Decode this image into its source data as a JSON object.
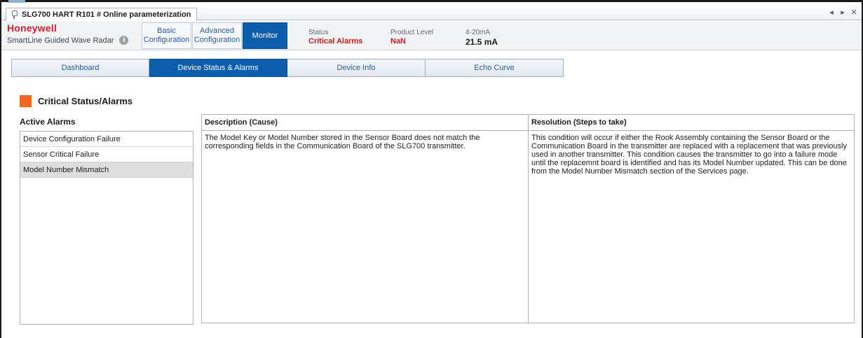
{
  "window": {
    "tab_title": "SLG700 HART R101 # Online parameterization",
    "controls": [
      "◂",
      "▸",
      "✕"
    ]
  },
  "header": {
    "brand": "Honeywell",
    "product": "SmartLine Guided Wave Radar",
    "nav": [
      {
        "label": "Basic Configuration",
        "active": false
      },
      {
        "label": "Advanced Configuration",
        "active": false
      },
      {
        "label": "Monitor",
        "active": true
      }
    ],
    "status": {
      "label": "Status",
      "value": "Critical Alarms"
    },
    "product_level": {
      "label": "Product Level",
      "value": "NaN"
    },
    "current": {
      "label": "4-20mA",
      "value": "21.5 mA"
    }
  },
  "subtabs": [
    {
      "label": "Dashboard",
      "active": false
    },
    {
      "label": "Device Status & Alarms",
      "active": true
    },
    {
      "label": "Device Info",
      "active": false
    },
    {
      "label": "Echo Curve",
      "active": false
    }
  ],
  "section": {
    "title": "Critical Status/Alarms"
  },
  "alarms": {
    "heading": "Active Alarms",
    "items": [
      {
        "label": "Device Configuration Failure",
        "selected": false
      },
      {
        "label": "Sensor Critical Failure",
        "selected": false
      },
      {
        "label": "Model Number Mismatch",
        "selected": true
      }
    ]
  },
  "details": {
    "description_header": "Description (Cause)",
    "description": "The Model Key or Model Number stored in the Sensor Board does not match the corresponding fields in the Communication Board of the SLG700 transmitter.",
    "resolution_header": "Resolution (Steps to take)",
    "resolution": "This condition will occur if either the Rook Assembly containing the Sensor Board or the Communication Board in the transmitter are replaced with a replacement that was previously used in another transmitter. This condition causes the transmitter to go into a failure mode until the replacemnt board is identified and has its Model Number updated. This can be done from the Model Number Mismatch section of the Services page."
  },
  "colors": {
    "accent_blue": "#0c5dab",
    "brand_red": "#d6202b",
    "alarm_red": "#d0161b",
    "section_orange": "#f26522"
  }
}
